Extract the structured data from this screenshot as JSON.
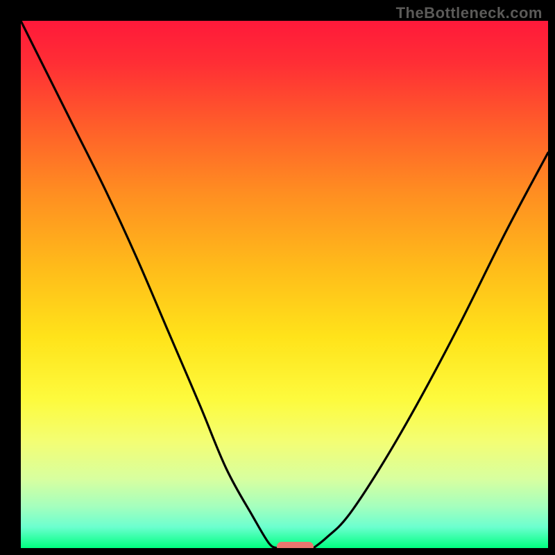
{
  "watermark": {
    "text": "TheBottleneck.com"
  },
  "chart_data": {
    "type": "line",
    "title": "",
    "xlabel": "",
    "ylabel": "",
    "xlim": [
      0,
      100
    ],
    "ylim": [
      0,
      100
    ],
    "grid": false,
    "background_gradient": {
      "stops": [
        {
          "pos": 0.0,
          "color": "#ff193a"
        },
        {
          "pos": 0.08,
          "color": "#ff2e35"
        },
        {
          "pos": 0.2,
          "color": "#ff5e2a"
        },
        {
          "pos": 0.33,
          "color": "#ff8f21"
        },
        {
          "pos": 0.47,
          "color": "#ffbc1a"
        },
        {
          "pos": 0.6,
          "color": "#ffe31a"
        },
        {
          "pos": 0.72,
          "color": "#fdfb3e"
        },
        {
          "pos": 0.8,
          "color": "#f3fe75"
        },
        {
          "pos": 0.87,
          "color": "#d7ffa0"
        },
        {
          "pos": 0.92,
          "color": "#a6ffbd"
        },
        {
          "pos": 0.96,
          "color": "#6cffcf"
        },
        {
          "pos": 1.0,
          "color": "#00ff80"
        }
      ]
    },
    "series": [
      {
        "name": "left-curve",
        "x": [
          0,
          5,
          10,
          16,
          22,
          28,
          34,
          39,
          44,
          47,
          48.5
        ],
        "y": [
          100,
          90,
          80,
          68,
          55,
          41,
          27,
          15,
          6,
          1,
          0
        ]
      },
      {
        "name": "right-curve",
        "x": [
          55.5,
          58,
          62,
          68,
          75,
          83,
          92,
          100
        ],
        "y": [
          0,
          2,
          6,
          15,
          27,
          42,
          60,
          75
        ]
      }
    ],
    "marker": {
      "x_center": 52,
      "width_pct": 7,
      "y": 0.2,
      "color": "#e9766f"
    }
  }
}
